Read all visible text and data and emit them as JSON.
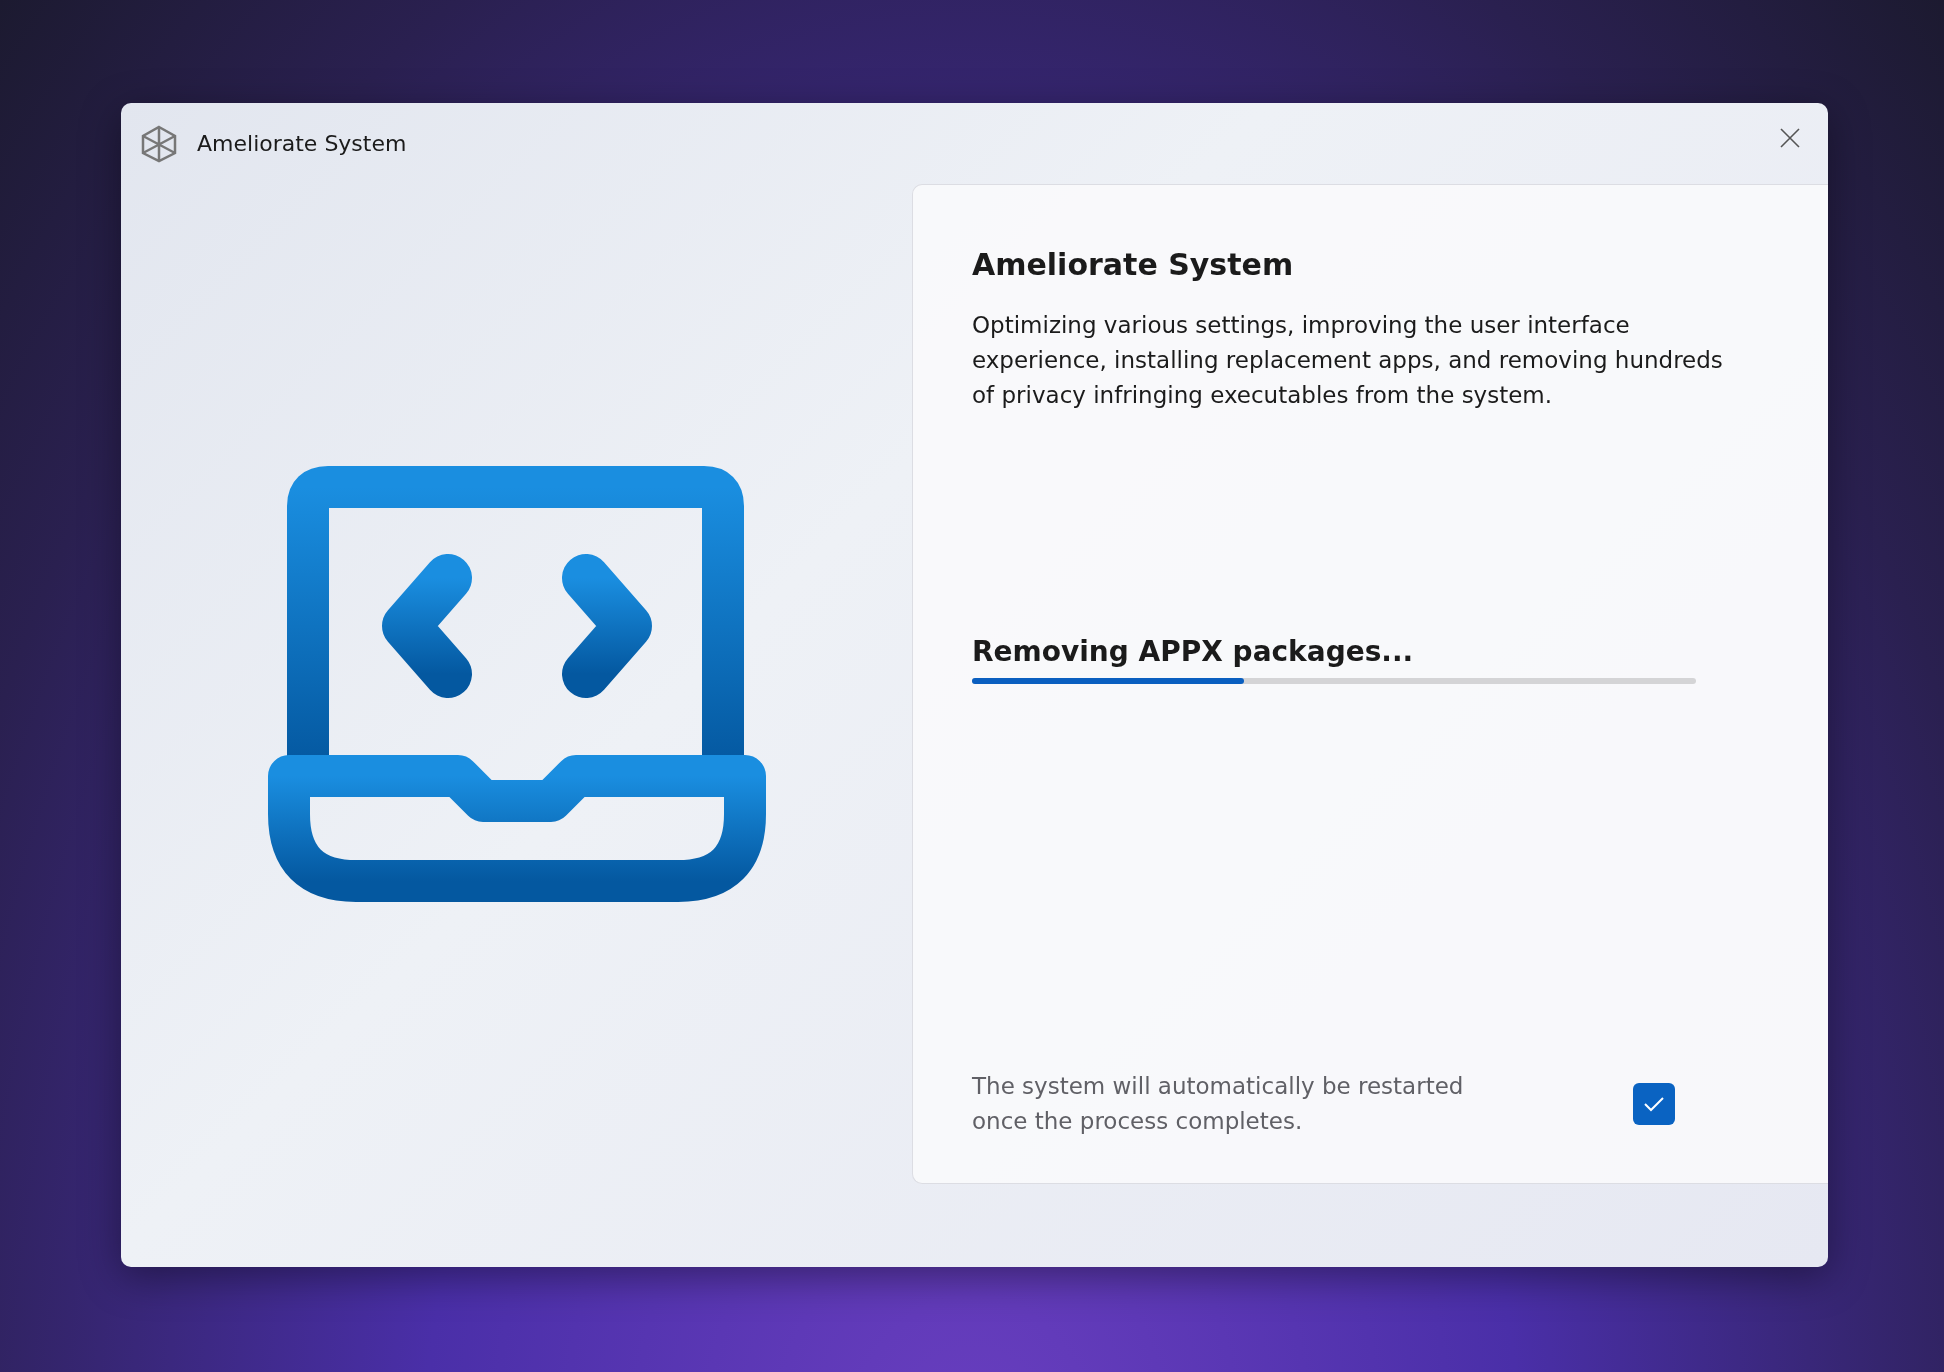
{
  "window": {
    "title": "Ameliorate System"
  },
  "panel": {
    "heading": "Ameliorate System",
    "description": "Optimizing various settings, improving the user interface experience, installing replacement apps, and removing hundreds of privacy infringing executables from the system.",
    "progress": {
      "label": "Removing APPX packages...",
      "level": 0.375
    },
    "restart_option": {
      "label": "The system will automatically be restarted once the process completes.",
      "checked": true
    }
  }
}
